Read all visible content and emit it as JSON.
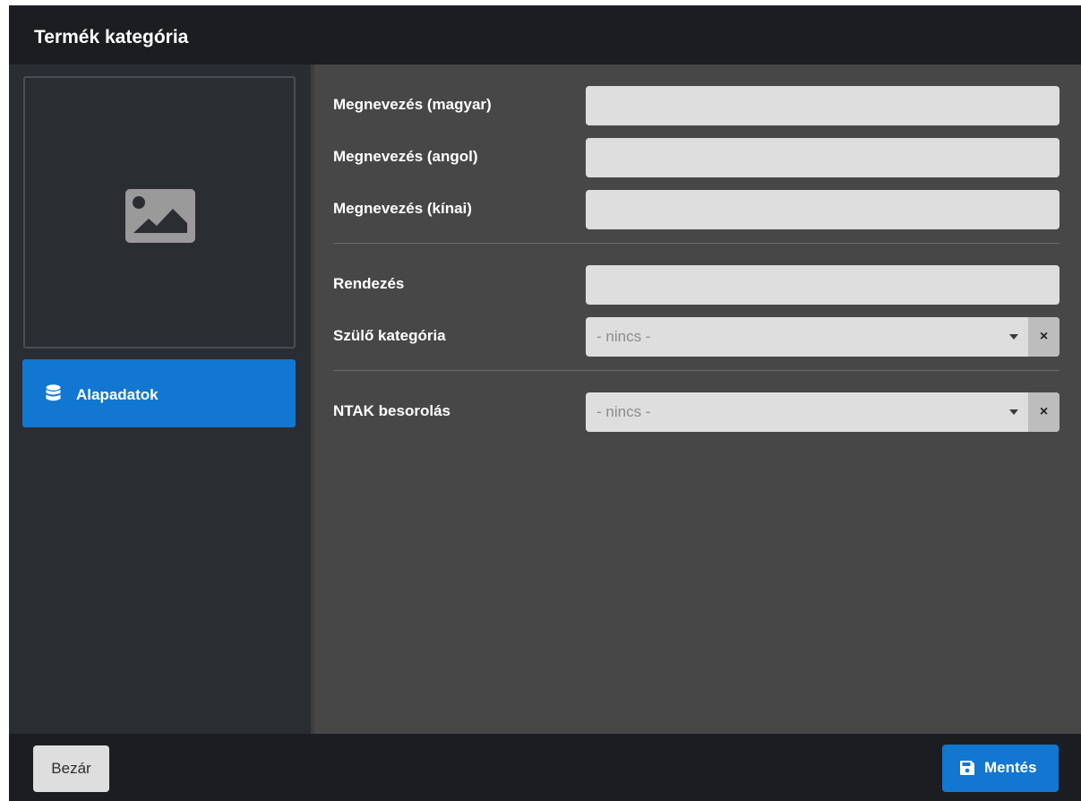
{
  "colors": {
    "header_bg": "#1b1d20",
    "sidebar_bg": "#2a2d32",
    "main_bg": "#474747",
    "accent": "#1177d1",
    "input_bg": "#dedede"
  },
  "header": {
    "title": "Termék kategória"
  },
  "sidebar": {
    "image_placeholder_icon": "image-icon",
    "nav": [
      {
        "label": "Alapadatok",
        "icon": "database-icon",
        "active": true
      }
    ]
  },
  "form": {
    "fields": [
      {
        "label": "Megnevezés (magyar)",
        "value": "",
        "placeholder": ""
      },
      {
        "label": "Megnevezés (angol)",
        "value": "",
        "placeholder": ""
      },
      {
        "label": "Megnevezés (kínai)",
        "value": "",
        "placeholder": ""
      },
      {
        "label": "Rendezés",
        "value": "",
        "placeholder": ""
      }
    ],
    "parent_category": {
      "label": "Szülő kategória",
      "value": "- nincs -",
      "clear": "×"
    },
    "ntak": {
      "label": "NTAK besorolás",
      "value": "- nincs -",
      "clear": "×"
    }
  },
  "footer": {
    "close_label": "Bezár",
    "save_label": "Mentés",
    "save_icon": "floppy-disk-icon"
  }
}
